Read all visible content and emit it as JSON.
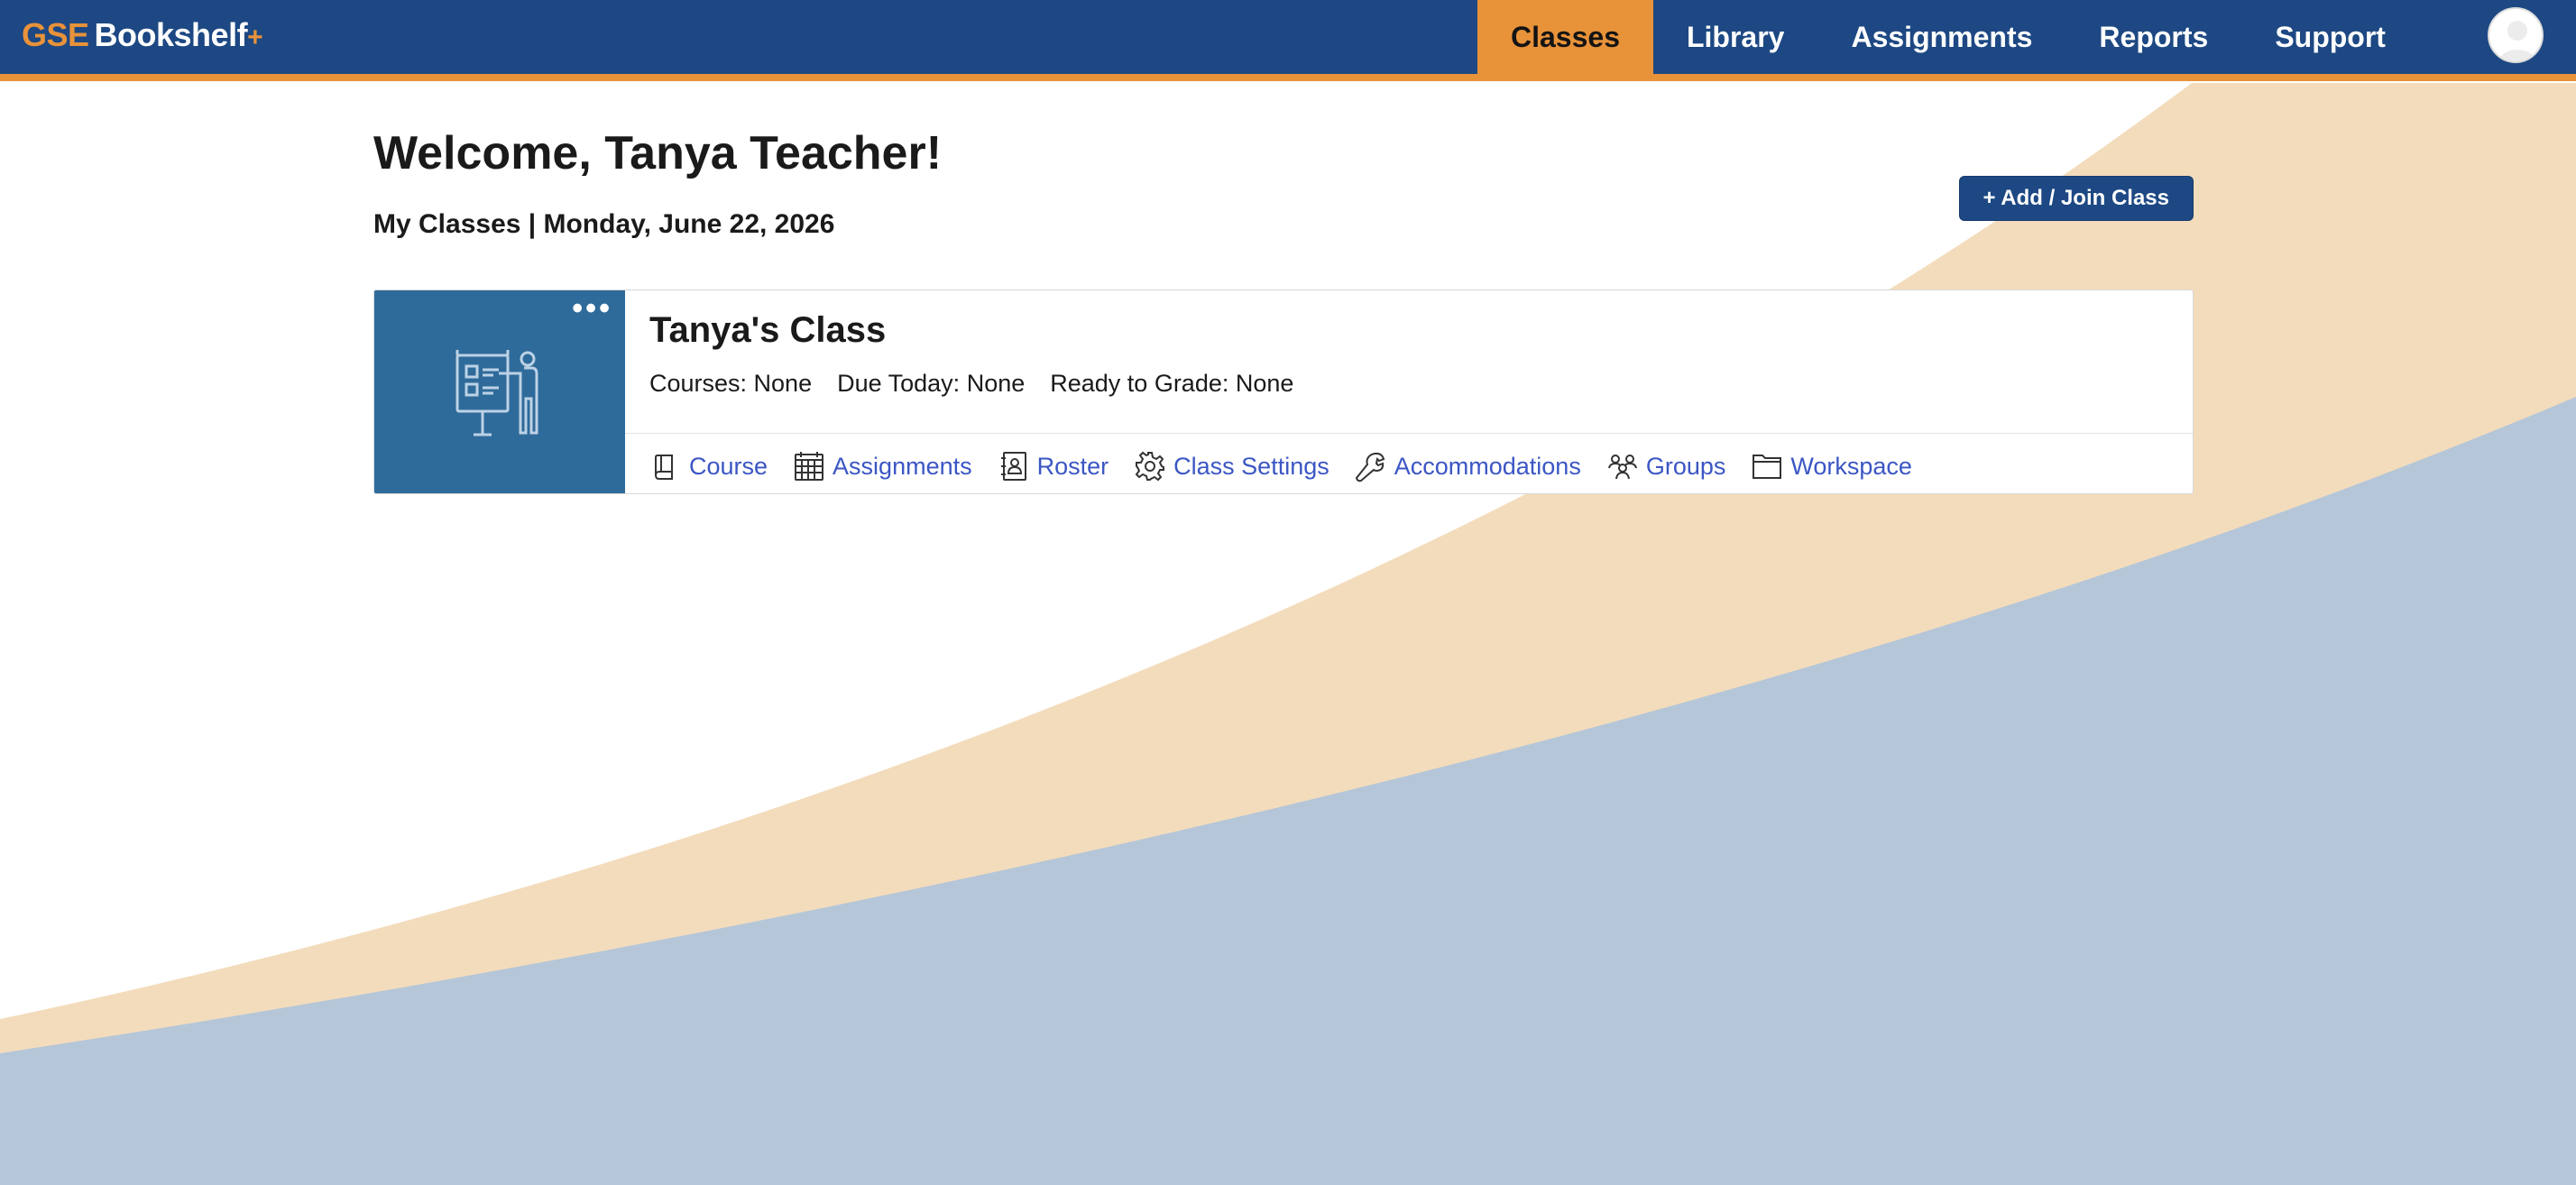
{
  "brand": {
    "prefix": "GSE",
    "name": "Bookshelf",
    "suffix": "+"
  },
  "nav": {
    "items": [
      {
        "label": "Classes",
        "active": true
      },
      {
        "label": "Library",
        "active": false
      },
      {
        "label": "Assignments",
        "active": false
      },
      {
        "label": "Reports",
        "active": false
      },
      {
        "label": "Support",
        "active": false
      }
    ]
  },
  "page": {
    "welcome": "Welcome, Tanya Teacher!",
    "subheading": "My Classes | Monday, June 22, 2026",
    "add_button": "+ Add / Join Class"
  },
  "class_card": {
    "title": "Tanya's Class",
    "menu": "•••",
    "stats": [
      "Courses: None",
      "Due Today: None",
      "Ready to Grade: None"
    ],
    "links": [
      {
        "label": "Course",
        "icon": "book-icon"
      },
      {
        "label": "Assignments",
        "icon": "calendar-icon"
      },
      {
        "label": "Roster",
        "icon": "address-book-icon"
      },
      {
        "label": "Class Settings",
        "icon": "gear-icon"
      },
      {
        "label": "Accommodations",
        "icon": "wrench-icon"
      },
      {
        "label": "Groups",
        "icon": "groups-icon"
      },
      {
        "label": "Workspace",
        "icon": "folder-icon"
      }
    ]
  },
  "colors": {
    "nav_bg": "#1d4883",
    "accent": "#e8923a",
    "link": "#3b56c4",
    "thumb_bg": "#2f6b9a",
    "wave_tan": "#f3dcbc",
    "wave_blue": "#b5c6d8"
  }
}
